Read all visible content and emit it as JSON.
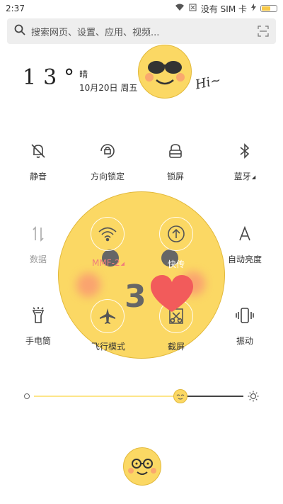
{
  "status": {
    "time": "2:37",
    "no_sim": "没有 SIM 卡",
    "battery_level": 0.6
  },
  "search": {
    "placeholder": "搜索网页、设置、应用、视频..."
  },
  "weather": {
    "temp": "13°",
    "condition": "晴",
    "date": "10月20日 周五",
    "greeting": "Hi~"
  },
  "toggles": [
    {
      "label": "静音",
      "icon": "bell-off-icon"
    },
    {
      "label": "方向锁定",
      "icon": "rotation-lock-icon"
    },
    {
      "label": "锁屏",
      "icon": "lock-icon"
    },
    {
      "label": "蓝牙",
      "icon": "bluetooth-icon"
    },
    {
      "label": "数据",
      "icon": "mobile-data-icon"
    },
    {
      "label": "MMF-2",
      "icon": "wifi-icon"
    },
    {
      "label": "快传",
      "icon": "upload-icon"
    },
    {
      "label": "自动亮度",
      "icon": "auto-brightness-icon"
    },
    {
      "label": "手电筒",
      "icon": "flashlight-icon"
    },
    {
      "label": "飞行模式",
      "icon": "airplane-icon"
    },
    {
      "label": "截屏",
      "icon": "screenshot-icon"
    },
    {
      "label": "振动",
      "icon": "vibrate-icon"
    }
  ],
  "overlay": {
    "number": "3"
  },
  "brightness": {
    "level": 0.7
  },
  "colors": {
    "accent": "#fbd864",
    "wifi_label": "#f07c7c"
  }
}
